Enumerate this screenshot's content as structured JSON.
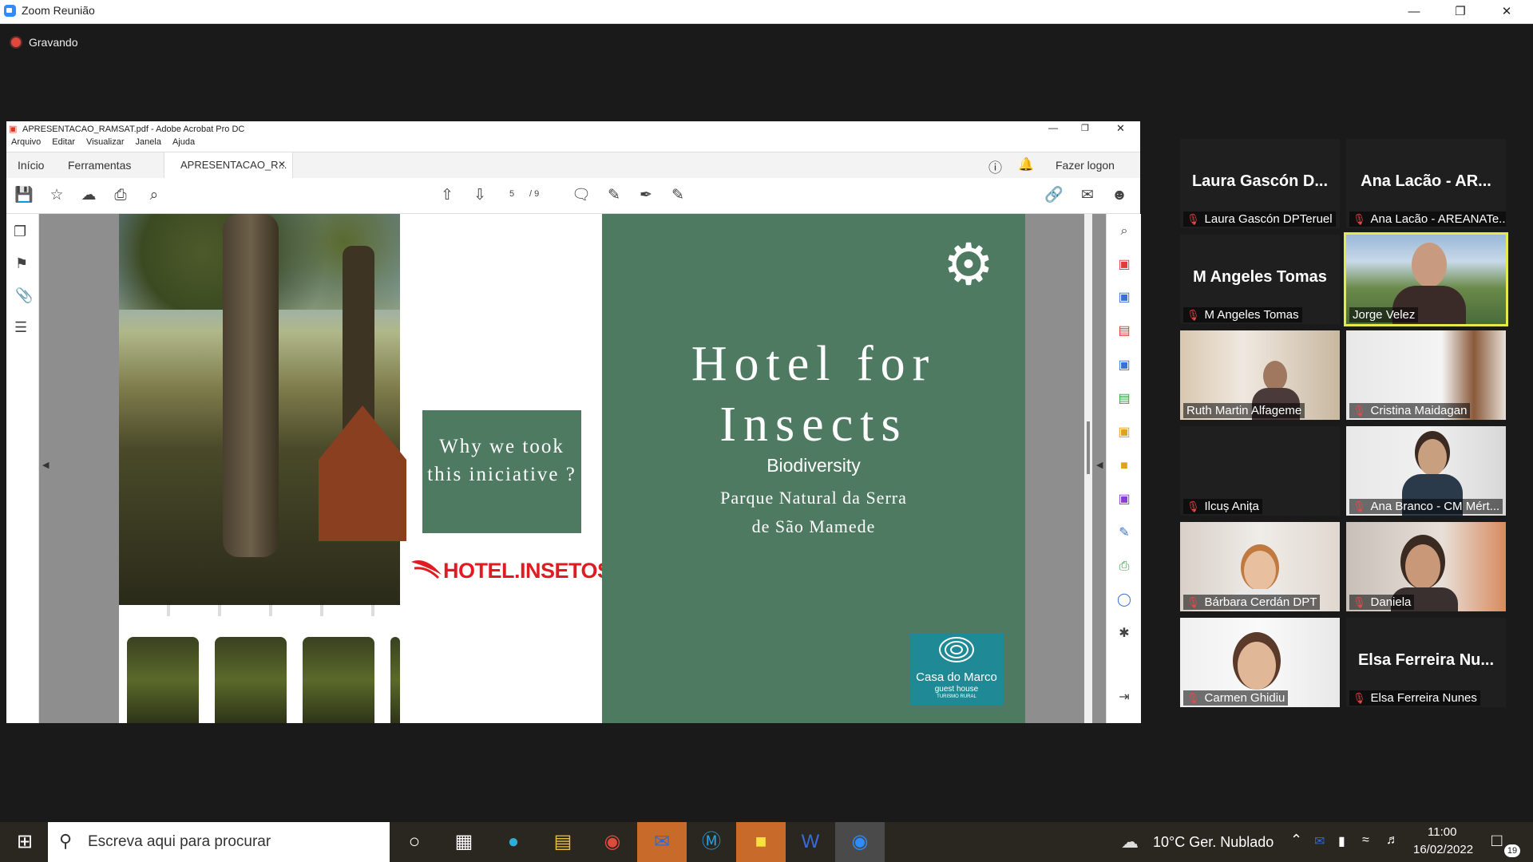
{
  "zoom": {
    "window_title": "Zoom Reunião",
    "recording_label": "Gravando"
  },
  "acrobat": {
    "window_title": "APRESENTACAO_RAMSAT.pdf - Adobe Acrobat Pro DC",
    "menu": [
      "Arquivo",
      "Editar",
      "Visualizar",
      "Janela",
      "Ajuda"
    ],
    "tabs": {
      "home": "Início",
      "tools": "Ferramentas",
      "doc": "APRESENTACAO_R..."
    },
    "login": "Fazer logon",
    "page_current": "5",
    "page_total": "/ 9"
  },
  "slide": {
    "why_text": "Why we took this iniciative ?",
    "hotel_logo": "HOTEL.INSETOS",
    "title_line1": "Hotel for",
    "title_line2": "Insects",
    "subtitle": "Biodiversity",
    "place_line1": "Parque Natural da Serra",
    "place_line2": "de São Mamede",
    "casa_name": "Casa do Marco",
    "casa_sub": "guest house",
    "casa_sub2": "TURISMO RURAL"
  },
  "participants": [
    {
      "big": "Laura Gascón D...",
      "name": "Laura Gascón DPTeruel",
      "muted": true
    },
    {
      "big": "Ana Lacão - AR...",
      "name": "Ana Lacão - AREANATe...",
      "muted": true
    },
    {
      "big": "M Angeles Tomas",
      "name": "M Angeles Tomas",
      "muted": true
    },
    {
      "big": "",
      "name": "Jorge Velez",
      "muted": false,
      "active": true
    },
    {
      "big": "",
      "name": "Ruth Martin Alfageme",
      "muted": false
    },
    {
      "big": "",
      "name": "Cristina Maidagan",
      "muted": true
    },
    {
      "big": "",
      "name": "Ilcuș Anița",
      "muted": true
    },
    {
      "big": "",
      "name": "Ana Branco - CM Mért...",
      "muted": true
    },
    {
      "big": "",
      "name": "Bárbara Cerdán DPT",
      "muted": true
    },
    {
      "big": "",
      "name": "Daniela",
      "muted": true
    },
    {
      "big": "",
      "name": "Carmen Ghidiu",
      "muted": true
    },
    {
      "big": "Elsa Ferreira Nu...",
      "name": "Elsa Ferreira Nunes",
      "muted": true
    }
  ],
  "taskbar": {
    "search_placeholder": "Escreva aqui para procurar",
    "weather": "10°C  Ger. Nublado",
    "time": "11:00",
    "date": "16/02/2022",
    "notifications": "19"
  }
}
